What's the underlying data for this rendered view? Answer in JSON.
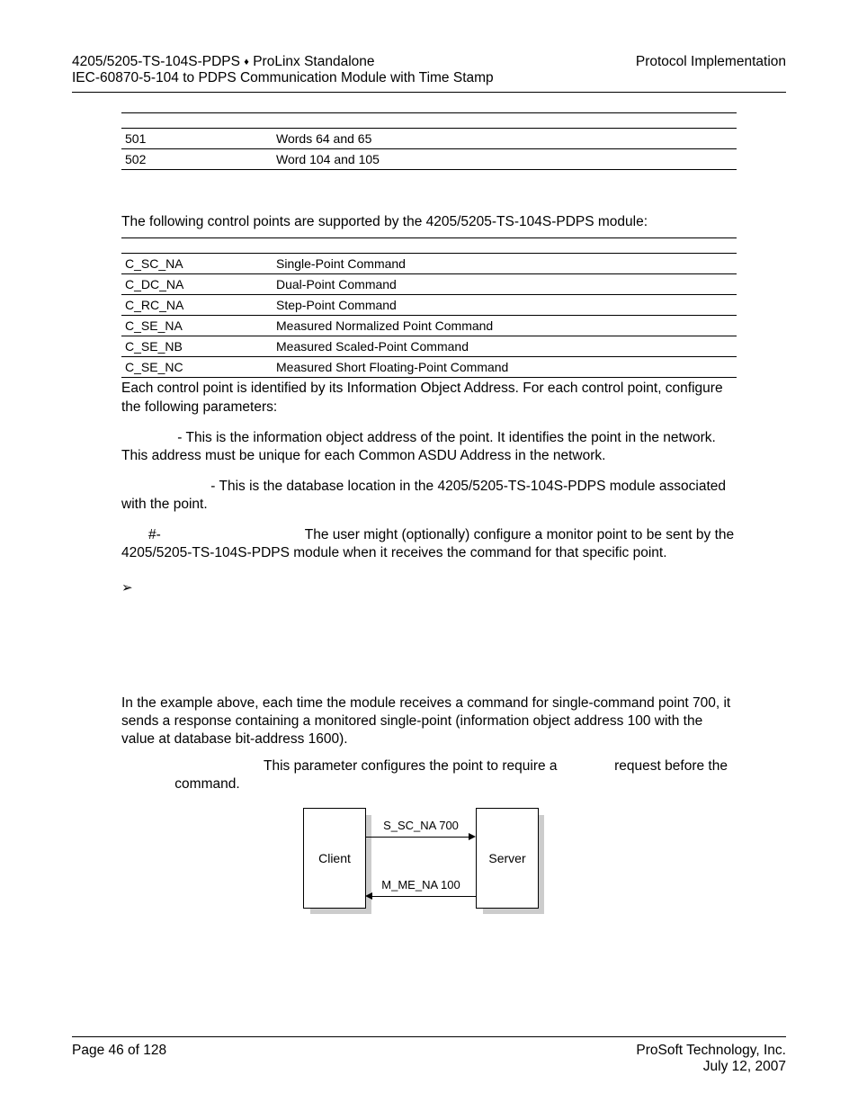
{
  "header": {
    "left_line1_a": "4205/5205-TS-104S-PDPS ",
    "diamond": "♦",
    "left_line1_b": " ProLinx Standalone",
    "right_line1": "Protocol Implementation",
    "left_line2": "IEC-60870-5-104 to PDPS Communication Module with Time Stamp"
  },
  "table1": {
    "rows": [
      {
        "c1": "501",
        "c2": "Words 64 and 65"
      },
      {
        "c1": "502",
        "c2": "Word 104 and 105"
      }
    ]
  },
  "intro_para": "The following control points are supported by the 4205/5205-TS-104S-PDPS module:",
  "table2": {
    "rows": [
      {
        "c1": "C_SC_NA",
        "c2": "Single-Point Command"
      },
      {
        "c1": "C_DC_NA",
        "c2": "Dual-Point Command"
      },
      {
        "c1": "C_RC_NA",
        "c2": "Step-Point Command"
      },
      {
        "c1": "C_SE_NA",
        "c2": "Measured Normalized Point Command"
      },
      {
        "c1": "C_SE_NB",
        "c2": "Measured Scaled-Point Command"
      },
      {
        "c1": "C_SE_NC",
        "c2": "Measured Short Floating-Point Command"
      }
    ]
  },
  "after_table2": "Each control point is identified by its Information Object Address. For each control point, configure the following parameters:",
  "p1": " - This is the information object address of the point. It identifies the point in the network. This address must be unique for each Common ASDU Address in the network.",
  "p2": " - This is the database location in the 4205/5205-TS-104S-PDPS module associated with the point.",
  "p3_pre": "#-",
  "p3_rest": "The user might (optionally) configure a monitor point to be sent by the 4205/5205-TS-104S-PDPS module when it receives the command for that specific point.",
  "bullet": "➢",
  "example_para": "In the example above, each time the module receives a command for single-command point 700, it sends a response containing a monitored single-point (information object address 100 with the value at database bit-address 1600).",
  "param_sentence_a": "This parameter configures the point to require a ",
  "param_sentence_b": " request before the ",
  "param_sentence_c": " command.",
  "figure": {
    "client": "Client",
    "server": "Server",
    "top": "S_SC_NA 700",
    "bottom": "M_ME_NA 100"
  },
  "footer": {
    "left": "Page 46 of 128",
    "right1": "ProSoft Technology, Inc.",
    "right2": "July 12, 2007"
  }
}
